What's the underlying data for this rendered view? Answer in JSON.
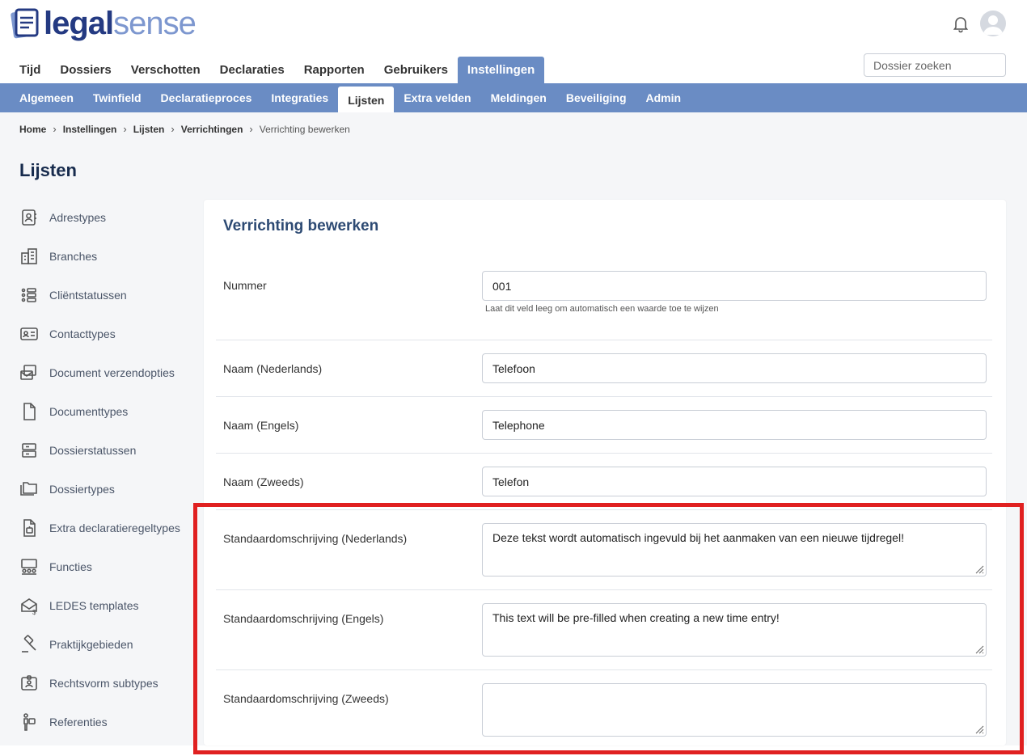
{
  "app": {
    "logo_legal": "legal",
    "logo_sense": "sense",
    "bell_icon": "bell-icon",
    "avatar_icon": "user-avatar-icon"
  },
  "main_nav": [
    "Tijd",
    "Dossiers",
    "Verschotten",
    "Declaraties",
    "Rapporten",
    "Gebruikers",
    "Instellingen"
  ],
  "main_nav_active": "Instellingen",
  "search": {
    "placeholder": "Dossier zoeken"
  },
  "sub_nav": [
    "Algemeen",
    "Twinfield",
    "Declaratieproces",
    "Integraties",
    "Lijsten",
    "Extra velden",
    "Meldingen",
    "Beveiliging",
    "Admin"
  ],
  "sub_nav_active": "Lijsten",
  "breadcrumb": [
    "Home",
    "Instellingen",
    "Lijsten",
    "Verrichtingen",
    "Verrichting bewerken"
  ],
  "page_title": "Lijsten",
  "sidebar": [
    {
      "label": "Adrestypes",
      "icon": "address-book-icon"
    },
    {
      "label": "Branches",
      "icon": "buildings-icon"
    },
    {
      "label": "Cliëntstatussen",
      "icon": "status-list-icon"
    },
    {
      "label": "Contacttypes",
      "icon": "contact-card-icon"
    },
    {
      "label": "Document verzendopties",
      "icon": "document-send-icon"
    },
    {
      "label": "Documenttypes",
      "icon": "document-icon"
    },
    {
      "label": "Dossierstatussen",
      "icon": "dossier-status-icon"
    },
    {
      "label": "Dossiertypes",
      "icon": "folders-icon"
    },
    {
      "label": "Extra declaratieregeltypes",
      "icon": "invoice-extra-icon"
    },
    {
      "label": "Functies",
      "icon": "people-group-icon"
    },
    {
      "label": "LEDES templates",
      "icon": "envelope-dollar-icon"
    },
    {
      "label": "Praktijkgebieden",
      "icon": "gavel-icon"
    },
    {
      "label": "Rechtsvorm subtypes",
      "icon": "id-badge-icon"
    },
    {
      "label": "Referenties",
      "icon": "person-referral-icon"
    }
  ],
  "form": {
    "title": "Verrichting bewerken",
    "nummer_label": "Nummer",
    "nummer_value": "001",
    "nummer_hint": "Laat dit veld leeg om automatisch een waarde toe te wijzen",
    "naam_nl_label": "Naam (Nederlands)",
    "naam_nl_value": "Telefoon",
    "naam_en_label": "Naam (Engels)",
    "naam_en_value": "Telephone",
    "naam_sv_label": "Naam (Zweeds)",
    "naam_sv_value": "Telefon",
    "desc_nl_label": "Standaardomschrijving (Nederlands)",
    "desc_nl_value": "Deze tekst wordt automatisch ingevuld bij het aanmaken van een nieuwe tijdregel!",
    "desc_en_label": "Standaardomschrijving (Engels)",
    "desc_en_value": "This text will be pre-filled when creating a new time entry!",
    "desc_sv_label": "Standaardomschrijving (Zweeds)",
    "desc_sv_value": ""
  },
  "colors": {
    "nav_blue": "#6a8cc4",
    "logo_dark": "#243a82",
    "logo_light": "#7d97cf",
    "highlight_red": "#e02020"
  }
}
